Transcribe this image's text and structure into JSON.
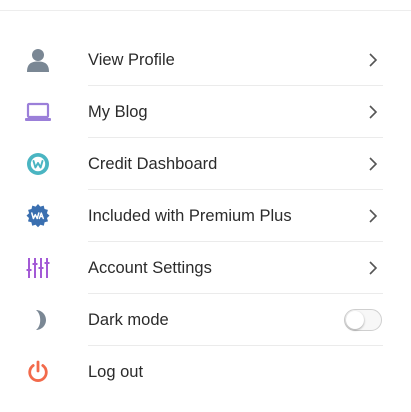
{
  "menu": {
    "items": [
      {
        "label": "View Profile",
        "icon": "person-icon",
        "action": "chevron"
      },
      {
        "label": "My Blog",
        "icon": "laptop-icon",
        "action": "chevron"
      },
      {
        "label": "Credit Dashboard",
        "icon": "credit-w-icon",
        "action": "chevron"
      },
      {
        "label": "Included with Premium Plus",
        "icon": "premium-badge-icon",
        "action": "chevron"
      },
      {
        "label": "Account Settings",
        "icon": "sliders-icon",
        "action": "chevron"
      },
      {
        "label": "Dark mode",
        "icon": "moon-icon",
        "action": "toggle",
        "toggle_on": false
      },
      {
        "label": "Log out",
        "icon": "power-icon",
        "action": "none"
      }
    ]
  },
  "colors": {
    "person": "#7a8794",
    "laptop": "#9b7fd9",
    "credit": "#4ab5c2",
    "premium": "#3a6fb0",
    "sliders": "#a35ad6",
    "moon": "#7a8794",
    "power": "#f26a4b",
    "chevron": "#555555"
  }
}
